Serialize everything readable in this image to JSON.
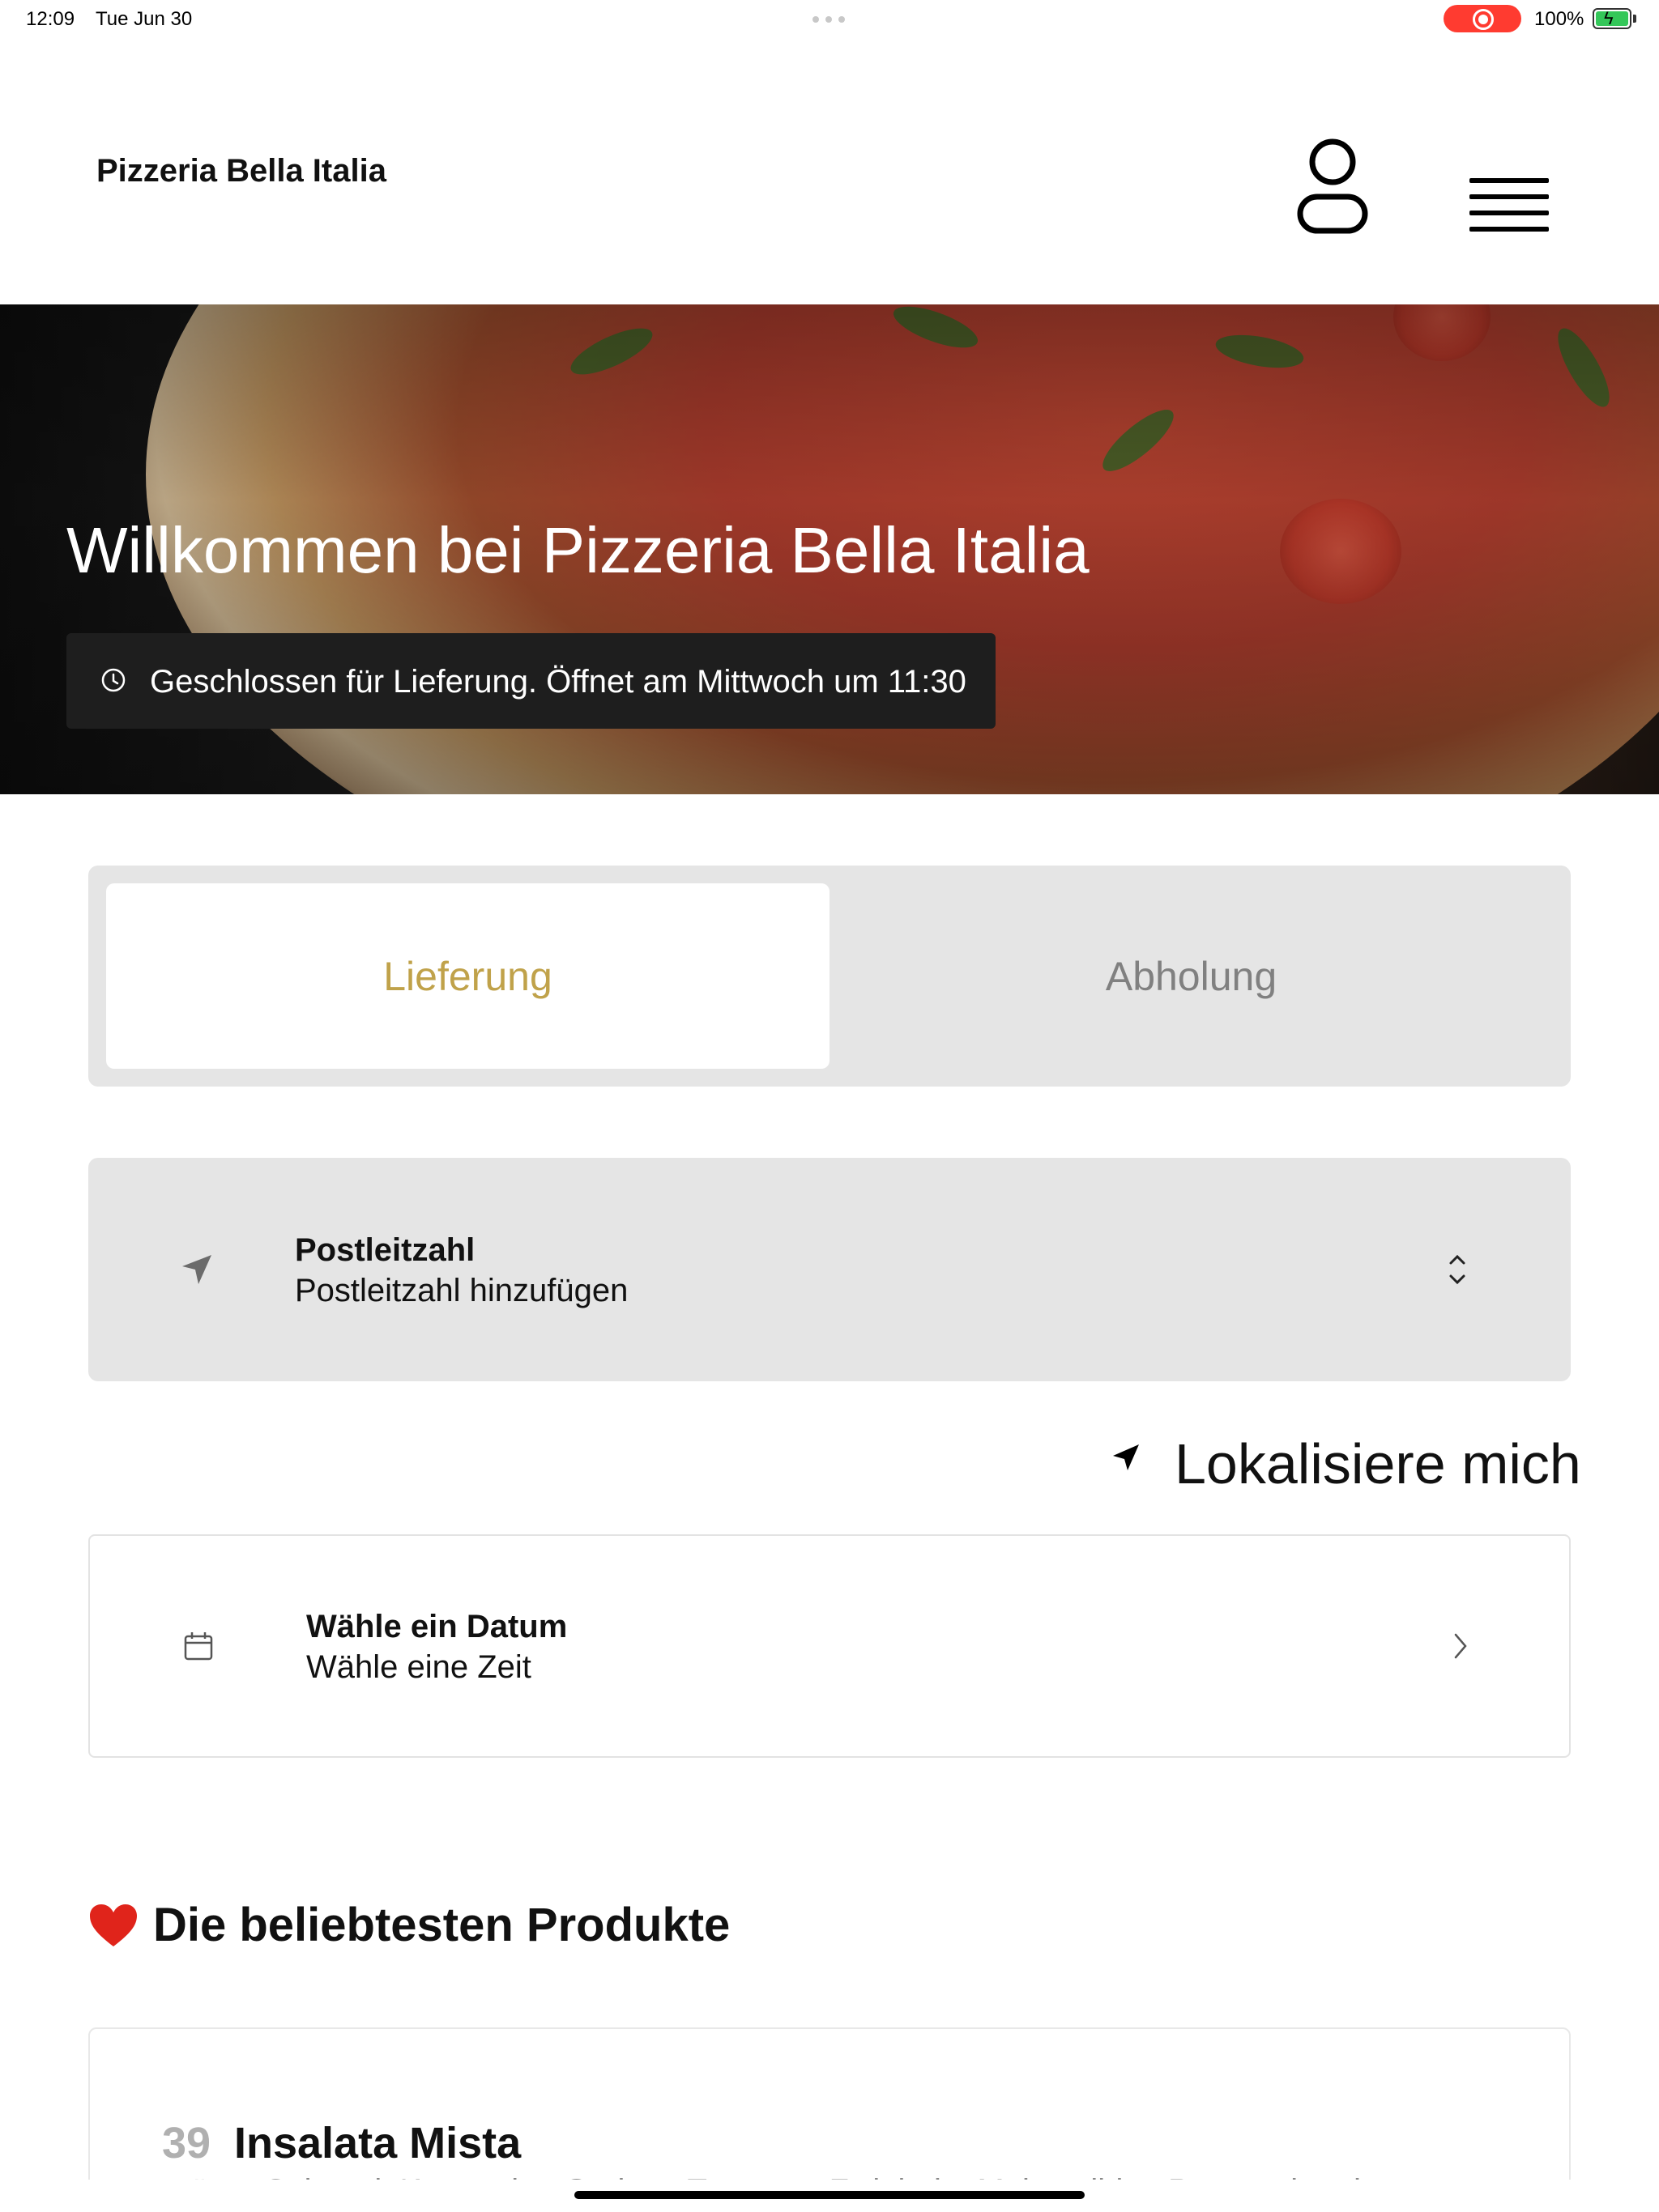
{
  "status_bar": {
    "time": "12:09",
    "date": "Tue Jun 30",
    "battery": "100%",
    "record_color": "#ff3b30",
    "battery_color": "#34c759"
  },
  "header": {
    "brand": "Pizzeria Bella Italia",
    "account_icon": "person-icon",
    "menu_icon": "hamburger-icon"
  },
  "hero": {
    "title": "Willkommen bei Pizzeria Bella Italia",
    "notice": "Geschlossen für Lieferung. Öffnet am Mittwoch um 11:30",
    "notice_icon": "clock-icon"
  },
  "order_type": {
    "options": [
      "Lieferung",
      "Abholung"
    ],
    "selected": "Lieferung",
    "active_color": "#c0a24a"
  },
  "postcode": {
    "label": "Postleitzahl",
    "placeholder": "Postleitzahl hinzufügen",
    "icon": "location-arrow-icon"
  },
  "locate": {
    "label": "Lokalisiere mich",
    "icon": "navigation-arrow-icon"
  },
  "schedule": {
    "label": "Wähle ein Datum",
    "sublabel": "Wähle eine Zeit",
    "icon": "calendar-icon"
  },
  "popular": {
    "title": "Die beliebtesten Produkte",
    "icon": "heart-icon",
    "items": [
      {
        "number": "39",
        "name": "Insalata Mista",
        "description": "grüner Salat mit Krautsalat, Gurken, Tomaten, Zwiebeln, Mais, milden Peperoni und"
      }
    ]
  }
}
